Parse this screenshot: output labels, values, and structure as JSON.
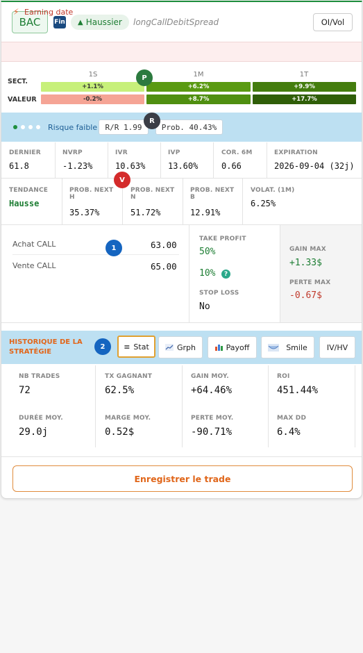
{
  "header": {
    "ticker": "BAC",
    "sector_badge": "Fin",
    "trend_icon": "▲",
    "trend": "Haussier",
    "strategy": "longCallDebitSpread",
    "oivol_button": "OI/Vol"
  },
  "earning": {
    "icon": "bolt-icon",
    "label": "Earning date"
  },
  "sector_perf": {
    "periods": [
      "1S",
      "1M",
      "1T"
    ],
    "rows": [
      {
        "label": "SECT.",
        "values": [
          "+1.1%",
          "+6.2%",
          "+9.9%"
        ]
      },
      {
        "label": "VALEUR",
        "values": [
          "-0.2%",
          "+8.7%",
          "+17.7%"
        ]
      }
    ],
    "marker_p": "P"
  },
  "risk": {
    "label": "Risque faible",
    "rr": "R/R 1.99",
    "prob": "Prob. 40.43%",
    "marker_r": "R"
  },
  "metrics": [
    {
      "label": "DERNIER",
      "value": "61.8"
    },
    {
      "label": "NVRP",
      "value": "-1.23%"
    },
    {
      "label": "IVR",
      "value": "10.63%"
    },
    {
      "label": "IVP",
      "value": "13.60%"
    },
    {
      "label": "COR. 6M",
      "value": "0.66"
    },
    {
      "label": "EXPIRATION",
      "value": "2026-09-04 (32j)"
    }
  ],
  "trend_row": {
    "tendance_label": "TENDANCE",
    "tendance_value": "Hausse",
    "marker_v": "V",
    "cells": [
      {
        "label1": "PROB. NEXT",
        "label2": "H",
        "value": "35.37%"
      },
      {
        "label1": "PROB. NEXT",
        "label2": "N",
        "value": "51.72%"
      },
      {
        "label1": "PROB. NEXT",
        "label2": "B",
        "value": "12.91%"
      }
    ],
    "volat_label": "VOLAT. (1M)",
    "volat_value": "6.25%"
  },
  "legs": {
    "marker": "1",
    "items": [
      {
        "label": "Achat CALL",
        "value": "63.00"
      },
      {
        "label": "Vente CALL",
        "value": "65.00"
      }
    ]
  },
  "targets": {
    "tp_label": "TAKE PROFIT",
    "tp_value": "50%",
    "tp2_value": "10%",
    "help_icon": "?",
    "sl_label": "STOP LOSS",
    "sl_value": "No",
    "gain_label": "GAIN MAX",
    "gain_value": "+1.33$",
    "loss_label": "PERTE MAX",
    "loss_value": "-0.67$"
  },
  "history": {
    "title": "HISTORIQUE DE LA STRATÉGIE",
    "marker": "2",
    "tabs": [
      {
        "icon": "≡",
        "label": "Stat"
      },
      {
        "icon": "line-chart-icon",
        "label": "Grph"
      },
      {
        "icon": "bar-chart-icon",
        "label": "Payoff"
      },
      {
        "icon": "smile-chart-icon",
        "label": "Smile"
      },
      {
        "icon": "",
        "label": "IV/HV"
      }
    ],
    "stats": [
      {
        "label": "NB TRADES",
        "value": "72"
      },
      {
        "label": "TX GAGNANT",
        "value": "62.5%"
      },
      {
        "label": "GAIN MOY.",
        "value": "+64.46%"
      },
      {
        "label": "ROI",
        "value": "451.44%"
      },
      {
        "label": "DURÉE MOY.",
        "value": "29.0j"
      },
      {
        "label": "MARGE MOY.",
        "value": "0.52$"
      },
      {
        "label": "PERTE MOY.",
        "value": "-90.71%"
      },
      {
        "label": "MAX DD",
        "value": "6.4%"
      }
    ]
  },
  "save_button": "Enregistrer le trade",
  "colors": {
    "accent_green": "#1e7e34",
    "loss_red": "#c0392b",
    "orange": "#e0661a",
    "strip_blue": "#bde0f2"
  }
}
